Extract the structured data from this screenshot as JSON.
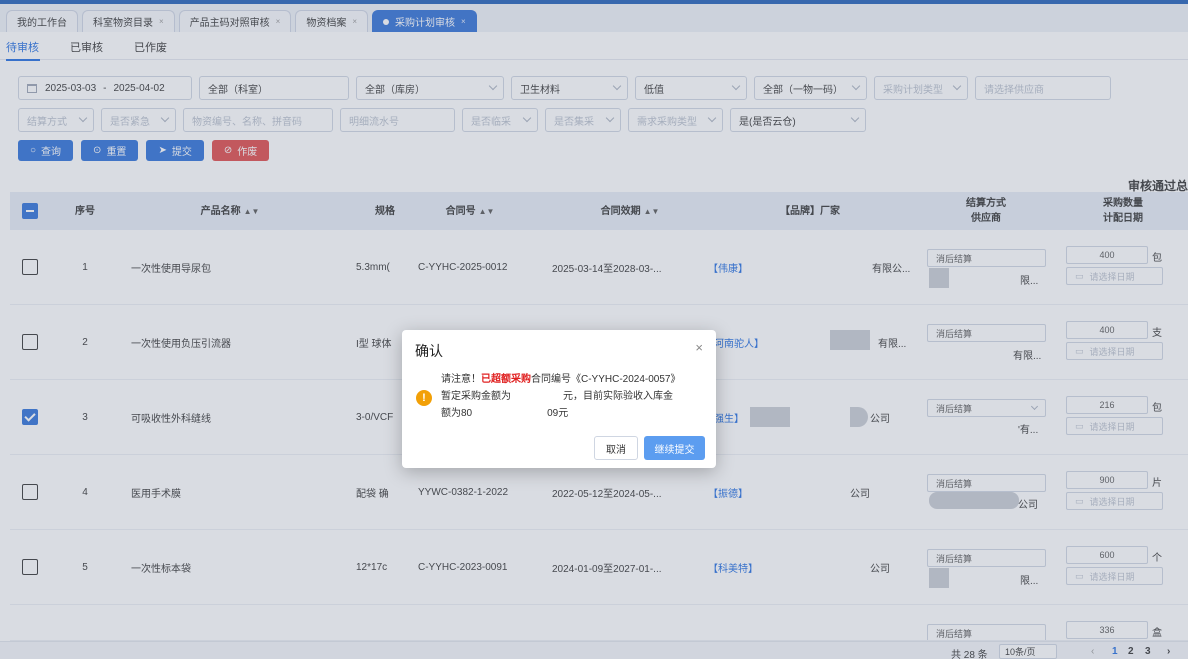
{
  "page_tabs": [
    {
      "label": "我的工作台",
      "closable": false,
      "active": false
    },
    {
      "label": "科室物资目录",
      "closable": true,
      "active": false
    },
    {
      "label": "产品主码对照审核",
      "closable": true,
      "active": false
    },
    {
      "label": "物资档案",
      "closable": true,
      "active": false
    },
    {
      "label": "采购计划审核",
      "closable": true,
      "active": true
    }
  ],
  "sub_tabs": [
    {
      "label": "待审核",
      "active": true
    },
    {
      "label": "已审核",
      "active": false
    },
    {
      "label": "已作废",
      "active": false
    }
  ],
  "filters": {
    "date_start": "2025-03-03",
    "date_sep": "-",
    "date_end": "2025-04-02",
    "dept": "全部（科室）",
    "warehouse": "全部（库房）",
    "category": "卫生材料",
    "value_level": "低值",
    "code_type": "全部（一物一码）",
    "plan_type_ph": "采购计划类型",
    "supplier_ph": "请选择供应商",
    "settle_ph": "结算方式",
    "urgent_ph": "是否紧急",
    "product_ph": "物资编号、名称、拼音码",
    "bill_ph": "明细流水号",
    "billing_ph": "是否临采",
    "bid_ph": "是否集采",
    "special_ph": "需求采购类型",
    "cloud": "是(是否云仓)"
  },
  "actions": {
    "query": "查询",
    "reset": "重置",
    "submit": "提交",
    "void": "作废"
  },
  "summary_text": "审核通过总",
  "table": {
    "headers": {
      "seq": "序号",
      "name": "产品名称",
      "spec": "规格",
      "contract": "合同号",
      "period": "合同效期",
      "brand": "【品牌】厂家",
      "settle_line1": "结算方式",
      "settle_line2": "供应商",
      "qty_line1": "采购数量",
      "qty_line2": "计配日期"
    },
    "rows": [
      {
        "seq": "1",
        "name": "一次性使用导尿包",
        "spec": "5.3mm(",
        "contract": "C-YYHC-2025-0012",
        "period": "2025-03-14至2028-03-...",
        "brand": "【伟康】",
        "maker": "有限公...",
        "settle": "消后结算",
        "supplier": "限...",
        "qty": "400",
        "unit": "包",
        "date_ph": "请选择日期",
        "checked": false
      },
      {
        "seq": "2",
        "name": "一次性使用负压引流器",
        "spec": "I型 球体",
        "contract": "",
        "period": "",
        "brand": "河南驼人】",
        "maker": "有限...",
        "settle": "消后结算",
        "supplier": "有限...",
        "qty": "400",
        "unit": "支",
        "date_ph": "请选择日期",
        "checked": false
      },
      {
        "seq": "3",
        "name": "可吸收性外科缝线",
        "spec": "3-0/VCF",
        "contract": "",
        "period": "",
        "brand": "强生】",
        "maker": "公司",
        "settle": "消后结算",
        "supplier": "'有...",
        "qty": "216",
        "unit": "包",
        "date_ph": "请选择日期",
        "checked": true
      },
      {
        "seq": "4",
        "name": "医用手术膜",
        "spec": "配袋 确",
        "contract": "YYWC-0382-1-2022",
        "period": "2022-05-12至2024-05-...",
        "brand": "【振德】",
        "maker": "公司",
        "settle": "消后结算",
        "supplier": "公司",
        "qty": "900",
        "unit": "片",
        "date_ph": "请选择日期",
        "checked": false
      },
      {
        "seq": "5",
        "name": "一次性标本袋",
        "spec": "12*17c",
        "contract": "C-YYHC-2023-0091",
        "period": "2024-01-09至2027-01-...",
        "brand": "【科美特】",
        "maker": "公司",
        "settle": "消后结算",
        "supplier": "限...",
        "qty": "600",
        "unit": "个",
        "date_ph": "请选择日期",
        "checked": false
      },
      {
        "seq": "",
        "name": "",
        "spec": "",
        "contract": "",
        "period": "",
        "brand": "",
        "maker": "",
        "settle": "消后结算",
        "supplier": "",
        "qty": "336",
        "unit": "盒",
        "date_ph": "",
        "checked": false
      }
    ]
  },
  "pager": {
    "total": "共 28 条",
    "page_size": "10条/页",
    "pages": [
      "1",
      "2",
      "3"
    ],
    "current": "1"
  },
  "dialog": {
    "title": "确认",
    "close": "×",
    "warn_icon": "!",
    "msg_pre": "请注意！",
    "msg_highlight": "已超额采购",
    "msg_line1_rest": "合同编号《C-YYHC-2024-0057》",
    "msg_line2_a": "暂定采购金额为",
    "msg_line2_b": "元，目前实际验收入库金",
    "msg_line3_a": "额为80",
    "msg_line3_b": "09元",
    "cancel": "取消",
    "confirm": "继续提交"
  }
}
